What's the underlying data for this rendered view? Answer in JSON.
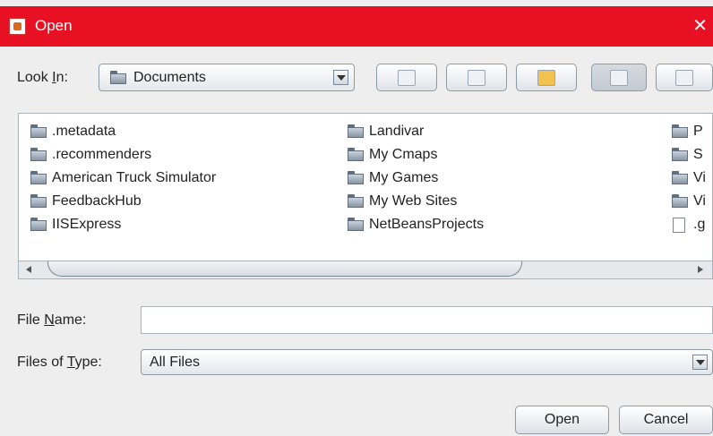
{
  "window": {
    "title": "Open",
    "close_glyph": "✕"
  },
  "lookin": {
    "label_prefix": "Look ",
    "label_mnemonic": "I",
    "label_suffix": "n:",
    "value": "Documents"
  },
  "toolbar": {
    "buttons": [
      {
        "icon": "up-folder-icon"
      },
      {
        "icon": "home-icon"
      },
      {
        "icon": "new-folder-icon"
      },
      {
        "icon": "list-view-icon",
        "pressed": true
      },
      {
        "icon": "details-view-icon"
      }
    ]
  },
  "files": {
    "col1": [
      ".metadata",
      ".recommenders",
      "American Truck Simulator",
      "FeedbackHub",
      "IISExpress"
    ],
    "col2": [
      "Landivar",
      "My Cmaps",
      "My Games",
      "My Web Sites",
      "NetBeansProjects"
    ],
    "col3": [
      "P",
      "S",
      "Vi",
      "Vi",
      ".g"
    ]
  },
  "filename": {
    "label_prefix": "File ",
    "label_mnemonic": "N",
    "label_suffix": "ame:",
    "value": ""
  },
  "filetype": {
    "label_prefix": "Files of ",
    "label_mnemonic": "T",
    "label_suffix": "ype:",
    "value": "All Files"
  },
  "buttons": {
    "open": "Open",
    "cancel": "Cancel"
  }
}
